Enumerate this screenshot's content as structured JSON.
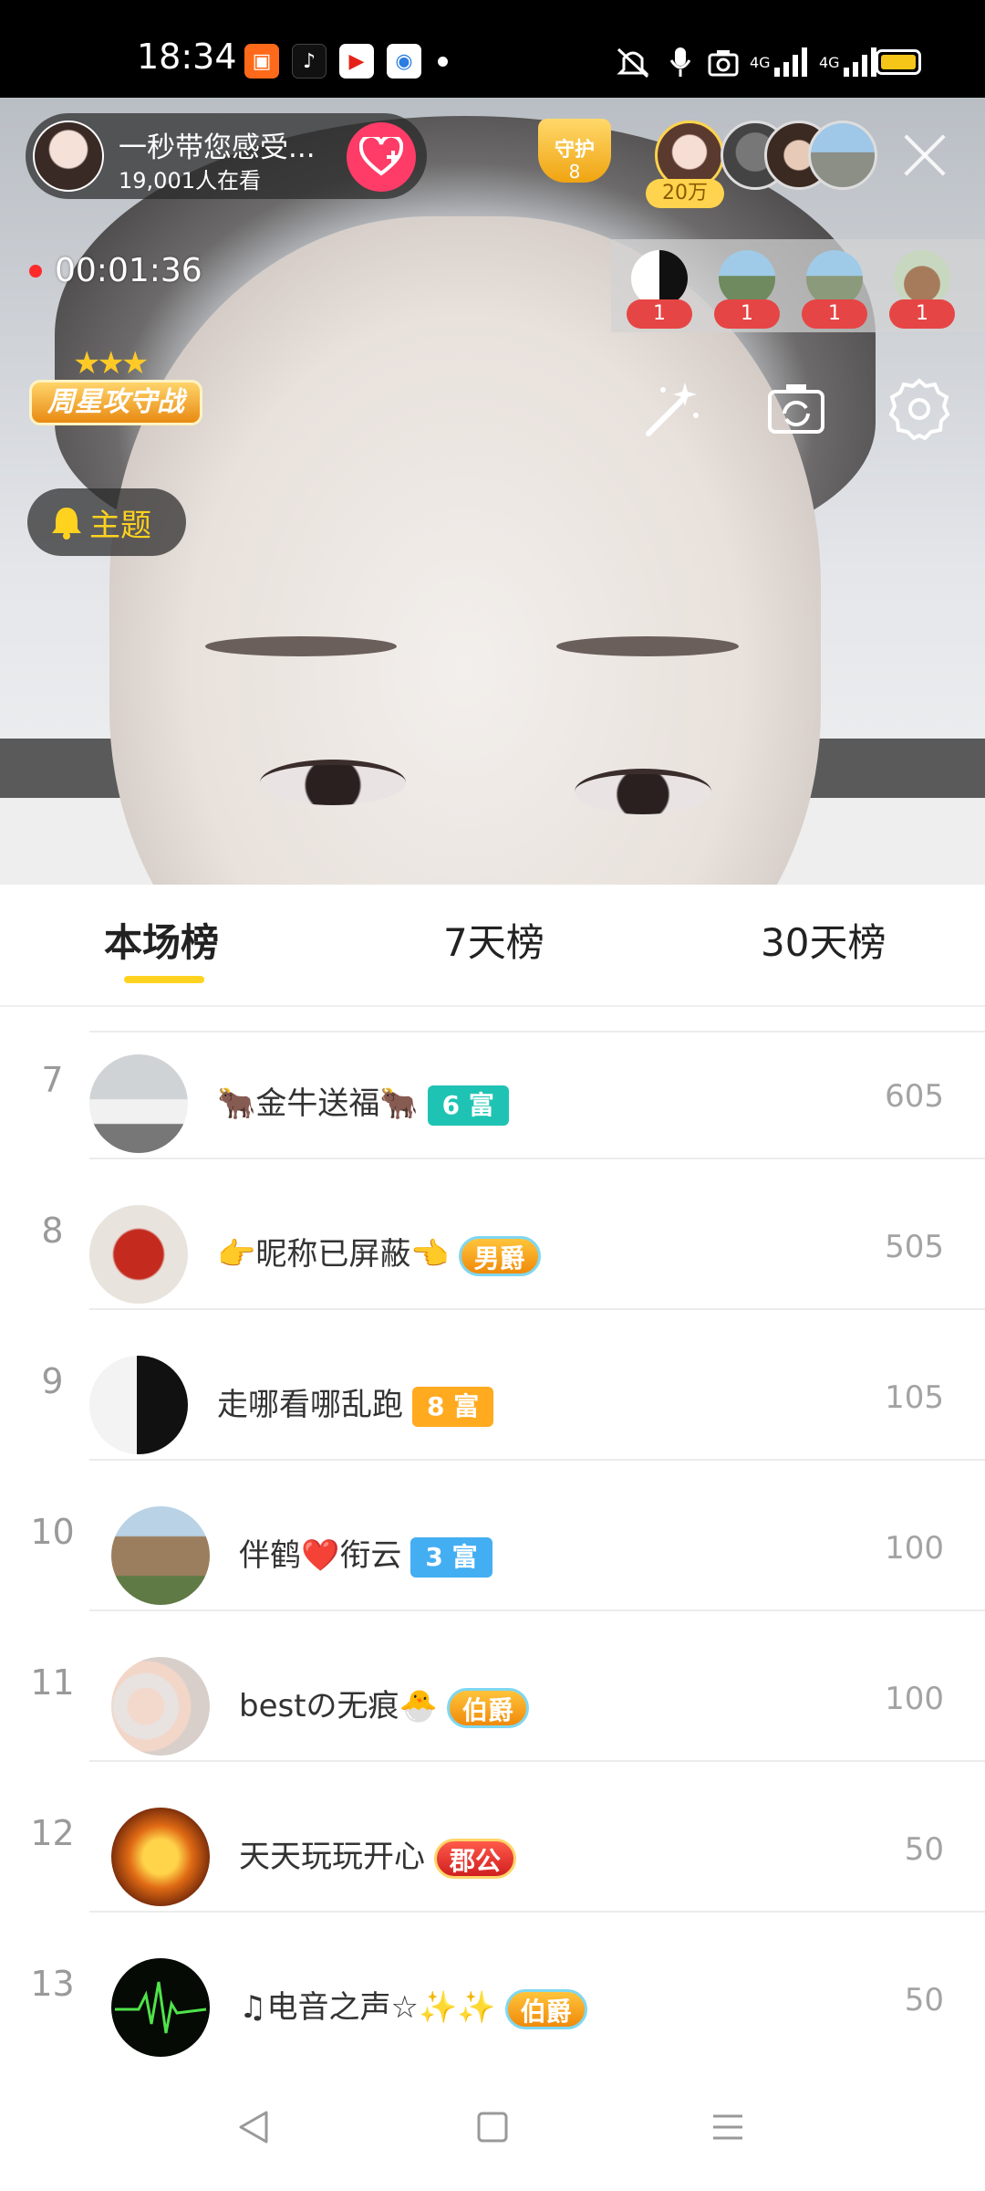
{
  "status_bar": {
    "time": "18:34",
    "network": "4G",
    "network2": "4G"
  },
  "stream": {
    "streamer_name": "一秒带您感受...",
    "viewers": "19,001人在看",
    "guard_label": "守护",
    "guard_count": "8",
    "top_fan_value": "20万",
    "timer": "00:01:36",
    "gift_counts": [
      "1",
      "1",
      "1",
      "1"
    ],
    "event_badge": "周星攻守战",
    "topic_label": "主题"
  },
  "tabs": [
    {
      "label": "本场榜",
      "active": true
    },
    {
      "label": "7天榜",
      "active": false
    },
    {
      "label": "30天榜",
      "active": false
    }
  ],
  "leaderboard": [
    {
      "rank": "7",
      "name": "🐂金牛送福🐂",
      "badge": "6 富",
      "badge_style": "teal",
      "score": "605"
    },
    {
      "rank": "8",
      "name": "👉昵称已屏蔽👈",
      "badge": "男爵",
      "badge_style": "noble",
      "score": "505"
    },
    {
      "rank": "9",
      "name": "走哪看哪乱跑",
      "badge": "8 富",
      "badge_style": "orange",
      "score": "105"
    },
    {
      "rank": "10",
      "name": "伴鹤❤️衔云",
      "badge": "3 富",
      "badge_style": "blue",
      "score": "100"
    },
    {
      "rank": "11",
      "name": "bestの无痕🐣",
      "badge": "伯爵",
      "badge_style": "noble",
      "score": "100"
    },
    {
      "rank": "12",
      "name": "天天玩玩开心",
      "badge": "郡公",
      "badge_style": "red",
      "score": "50"
    },
    {
      "rank": "13",
      "name": "♫电音之声☆✨✨",
      "badge": "伯爵",
      "badge_style": "noble",
      "score": "50"
    }
  ],
  "colors": {
    "accent_yellow": "#ffd21f",
    "follow_pink": "#ff3b67",
    "gift_red": "#e64545"
  }
}
